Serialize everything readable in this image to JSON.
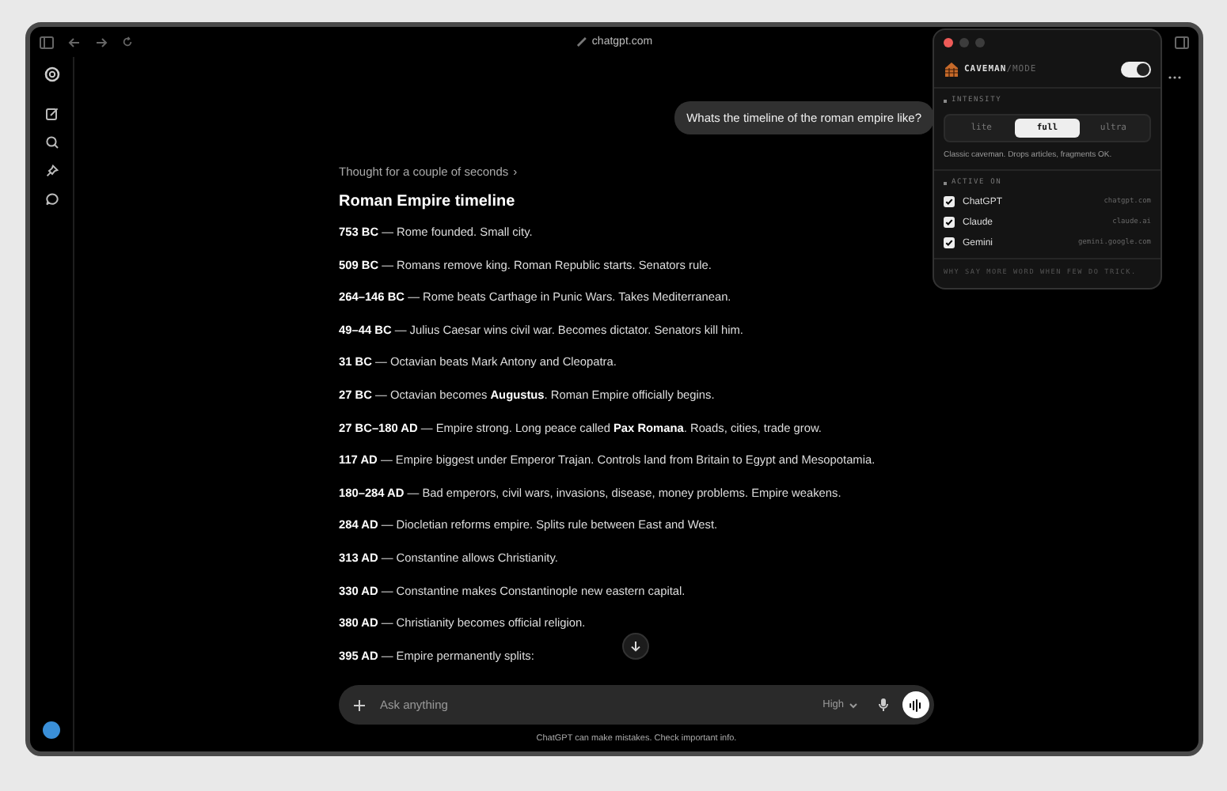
{
  "browser": {
    "url": "chatgpt.com"
  },
  "chat": {
    "user_message": "Whats the timeline of the roman empire like?",
    "thought": "Thought for a couple of seconds",
    "thought_chevron": "›",
    "heading": "Roman Empire timeline",
    "entries": [
      "**753 BC** — Rome founded. Small city.",
      "**509 BC** — Romans remove king. Roman Republic starts. Senators rule.",
      "**264–146 BC** — Rome beats Carthage in Punic Wars. Takes Mediterranean.",
      "**49–44 BC** — Julius Caesar wins civil war. Becomes dictator. Senators kill him.",
      "**31 BC** — Octavian beats Mark Antony and Cleopatra.",
      "**27 BC** — Octavian becomes **Augustus**. Roman Empire officially begins.",
      "**27 BC–180 AD** — Empire strong. Long peace called **Pax Romana**. Roads, cities, trade grow.",
      "**117 AD** — Empire biggest under Emperor Trajan. Controls land from Britain to Egypt and Mesopotamia.",
      "**180–284 AD** — Bad emperors, civil wars, invasions, disease, money problems. Empire weakens.",
      "**284 AD** — Diocletian reforms empire. Splits rule between East and West.",
      "**313 AD** — Constantine allows Christianity.",
      "**330 AD** — Constantine makes Constantinople new eastern capital.",
      "**380 AD** — Christianity becomes official religion.",
      "**395 AD** — Empire permanently splits:"
    ]
  },
  "composer": {
    "placeholder": "Ask anything",
    "model": "High",
    "disclaimer": "ChatGPT can make mistakes. Check important info."
  },
  "extension": {
    "title": "CAVEMAN",
    "title_suffix": "/MODE",
    "on": true,
    "intensity_label": "INTENSITY",
    "segments": [
      {
        "label": "lite",
        "selected": false
      },
      {
        "label": "full",
        "selected": true
      },
      {
        "label": "ultra",
        "selected": false
      }
    ],
    "description": "Classic caveman. Drops articles, fragments OK.",
    "active_label": "ACTIVE ON",
    "sites": [
      {
        "name": "ChatGPT",
        "domain": "chatgpt.com",
        "checked": true
      },
      {
        "name": "Claude",
        "domain": "claude.ai",
        "checked": true
      },
      {
        "name": "Gemini",
        "domain": "gemini.google.com",
        "checked": true
      }
    ],
    "footer": "WHY SAY MORE WORD WHEN FEW DO TRICK."
  }
}
